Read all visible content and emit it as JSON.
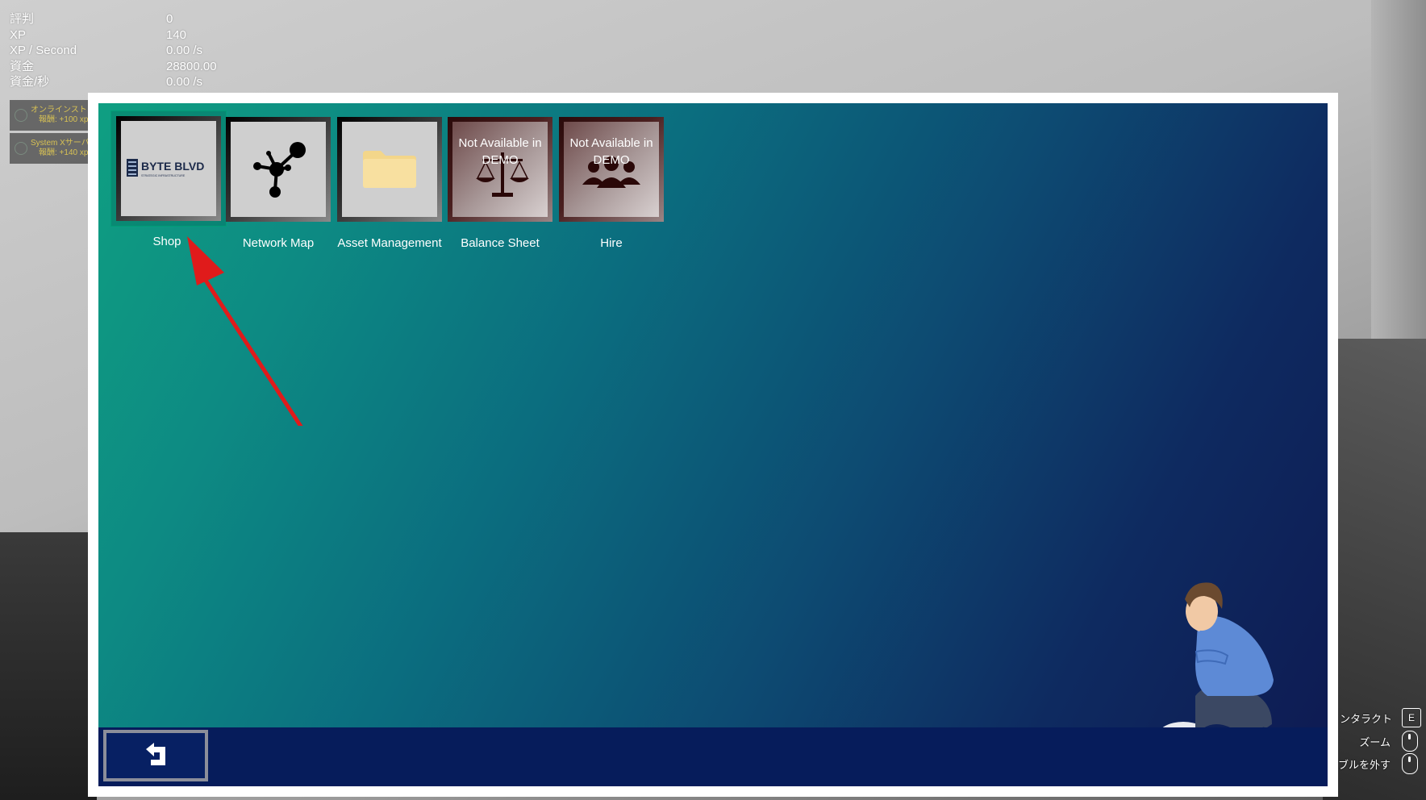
{
  "stats": [
    {
      "label": "評判",
      "value": "0"
    },
    {
      "label": "XP",
      "value": "140"
    },
    {
      "label": "XP / Second",
      "value": "0.00 /s"
    },
    {
      "label": "資金",
      "value": "28800.00"
    },
    {
      "label": "資金/秒",
      "value": "0.00 /s"
    }
  ],
  "quests": [
    {
      "title": "オンラインスト",
      "reward": "報酬: +100 xp"
    },
    {
      "title": "System Xサーバ",
      "reward": "報酬: +140 xp"
    }
  ],
  "apps": [
    {
      "label": "Shop",
      "logo_text": "BYTE BLVD",
      "logo_sub": "STRATEGIC INFRASTRUCTURE"
    },
    {
      "label": "Network Map"
    },
    {
      "label": "Asset Management"
    },
    {
      "label": "Balance Sheet",
      "overlay": "Not Available in DEMO"
    },
    {
      "label": "Hire",
      "overlay": "Not Available in DEMO"
    }
  ],
  "hints": [
    {
      "label": "ンタラクト",
      "key": "E"
    },
    {
      "label": "ズーム",
      "icon": "mouse-scroll-icon"
    },
    {
      "label": "ブルを外す",
      "icon": "mouse-click-icon"
    }
  ],
  "colors": {
    "accent_arrow": "#e01b1b",
    "taskbar": "#061c5b",
    "quest_text": "#d8c254"
  }
}
